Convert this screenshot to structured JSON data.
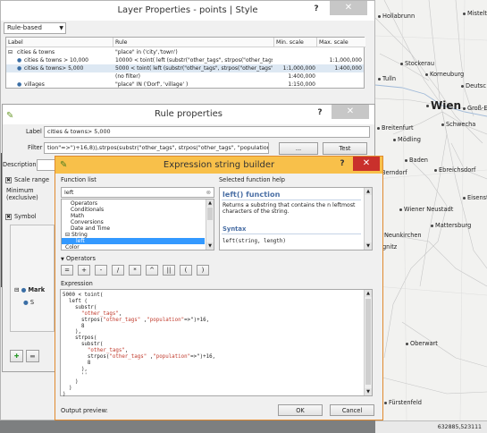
{
  "colors": {
    "accent_orange": "#f8c04a",
    "close_red": "#c9302c",
    "selection_blue": "#3399ff",
    "help_title_blue": "#4a6fa5",
    "string_literal_red": "#c0392b"
  },
  "map": {
    "cities": [
      {
        "name": "Hollabrunn"
      },
      {
        "name": "Mistelt"
      },
      {
        "name": "Stockerau"
      },
      {
        "name": "Tulln"
      },
      {
        "name": "Korneuburg"
      },
      {
        "name": "Deutsc"
      },
      {
        "name": "Wien"
      },
      {
        "name": "Groß-E"
      },
      {
        "name": "Schwecha"
      },
      {
        "name": "Breitenfurt"
      },
      {
        "name": "Mödling"
      },
      {
        "name": "Baden"
      },
      {
        "name": "Berndorf"
      },
      {
        "name": "Ebreichsdorf"
      },
      {
        "name": "Eisenst"
      },
      {
        "name": "Wiener Neustadt"
      },
      {
        "name": "Mattersburg"
      },
      {
        "name": "Neunkirchen"
      },
      {
        "name": "gnitz"
      },
      {
        "name": "Oberwart"
      },
      {
        "name": "Fürstenfeld"
      }
    ],
    "coordinates": "632885,523111"
  },
  "layer_properties": {
    "title": "Layer Properties - points | Style",
    "help_label": "?",
    "close_label": "✕",
    "renderer": "Rule-based",
    "columns": [
      "Label",
      "Rule",
      "Min. scale",
      "Max. scale"
    ],
    "rows": [
      {
        "label": "cities & towns",
        "rule": "\"place\" in ('city','town')",
        "min": "",
        "max": "",
        "indent": 0,
        "expander": "⊟"
      },
      {
        "label": "cities & towns > 10,000",
        "rule": "10000 < toint( left (substr(\"other_tags\", strpos(\"other_tags\",'...",
        "min": "",
        "max": "1:1,000,000",
        "indent": 1,
        "expander": ""
      },
      {
        "label": "cities & towns> 5,000",
        "rule": "5000 < toint( left (substr(\"other_tags\", strpos(\"other_tags\", \"...",
        "min": "1:1,000,000",
        "max": "1:400,000",
        "indent": 1,
        "expander": "",
        "selected": true
      },
      {
        "label": "",
        "rule": "(no filter)",
        "min": "1:400,000",
        "max": "",
        "indent": 2,
        "expander": ""
      },
      {
        "label": "villages",
        "rule": "\"place\" IN ('Dorf', 'village' )",
        "min": "1:150,000",
        "max": "",
        "indent": 1,
        "expander": ""
      }
    ]
  },
  "rule_properties": {
    "title": "Rule properties",
    "help_label": "?",
    "close_label": "✕",
    "label_caption": "Label",
    "label_value": "cities & towns> 5,000",
    "filter_caption": "Filter",
    "filter_value": "tion\"=>\")+16,8)),strpos(substr(\"other_tags\", strpos(\"other_tags\", \"population\"=>\")+16,8),\"\")))",
    "ellipsis_label": "...",
    "test_label": "Test",
    "description_caption": "Description",
    "scale_range_label": "Scale range",
    "minimum_label": "Minimum",
    "minimum_sub": "(exclusive)",
    "symbol_label": "Symbol",
    "marker_label": "Mark",
    "simple_label": "S"
  },
  "expression_builder": {
    "title": "Expression string builder",
    "help_label": "?",
    "close_label": "✕",
    "function_list_label": "Function list",
    "selected_help_label": "Selected function help",
    "search_value": "left",
    "functions": [
      {
        "label": "Operators",
        "indent": 1
      },
      {
        "label": "Conditionals",
        "indent": 1
      },
      {
        "label": "Math",
        "indent": 1
      },
      {
        "label": "Conversions",
        "indent": 1
      },
      {
        "label": "Date and Time",
        "indent": 1
      },
      {
        "label": "String",
        "indent": 0,
        "expander": "⊟"
      },
      {
        "label": "left",
        "indent": 2,
        "selected": true
      },
      {
        "label": "Color",
        "indent": 0
      }
    ],
    "help_title": "left() function",
    "help_text": "Returns a substring that contains the n leftmost characters of the string.",
    "syntax_title": "Syntax",
    "syntax_text": "left(string, length)",
    "operators_label": "Operators",
    "operators": [
      "=",
      "+",
      "-",
      "/",
      "*",
      "^",
      "||",
      "(",
      ")"
    ],
    "expression_label": "Expression",
    "expression_lines": [
      "5000 < toint(",
      "  left (",
      "    substr(",
      "      \"other_tags\",",
      "      strpos(\"other_tags\" ,\"population\"=>\")+16,",
      "      8",
      "    ),",
      "    strpos(",
      "      substr(",
      "        \"other_tags\",",
      "        strpos(\"other_tags\" ,\"population\"=>\")+16,",
      "        8",
      "      ),",
      "      ''",
      "    )",
      "  )",
      ")"
    ],
    "output_preview_label": "Output preview:",
    "ok_label": "OK",
    "cancel_label": "Cancel"
  }
}
